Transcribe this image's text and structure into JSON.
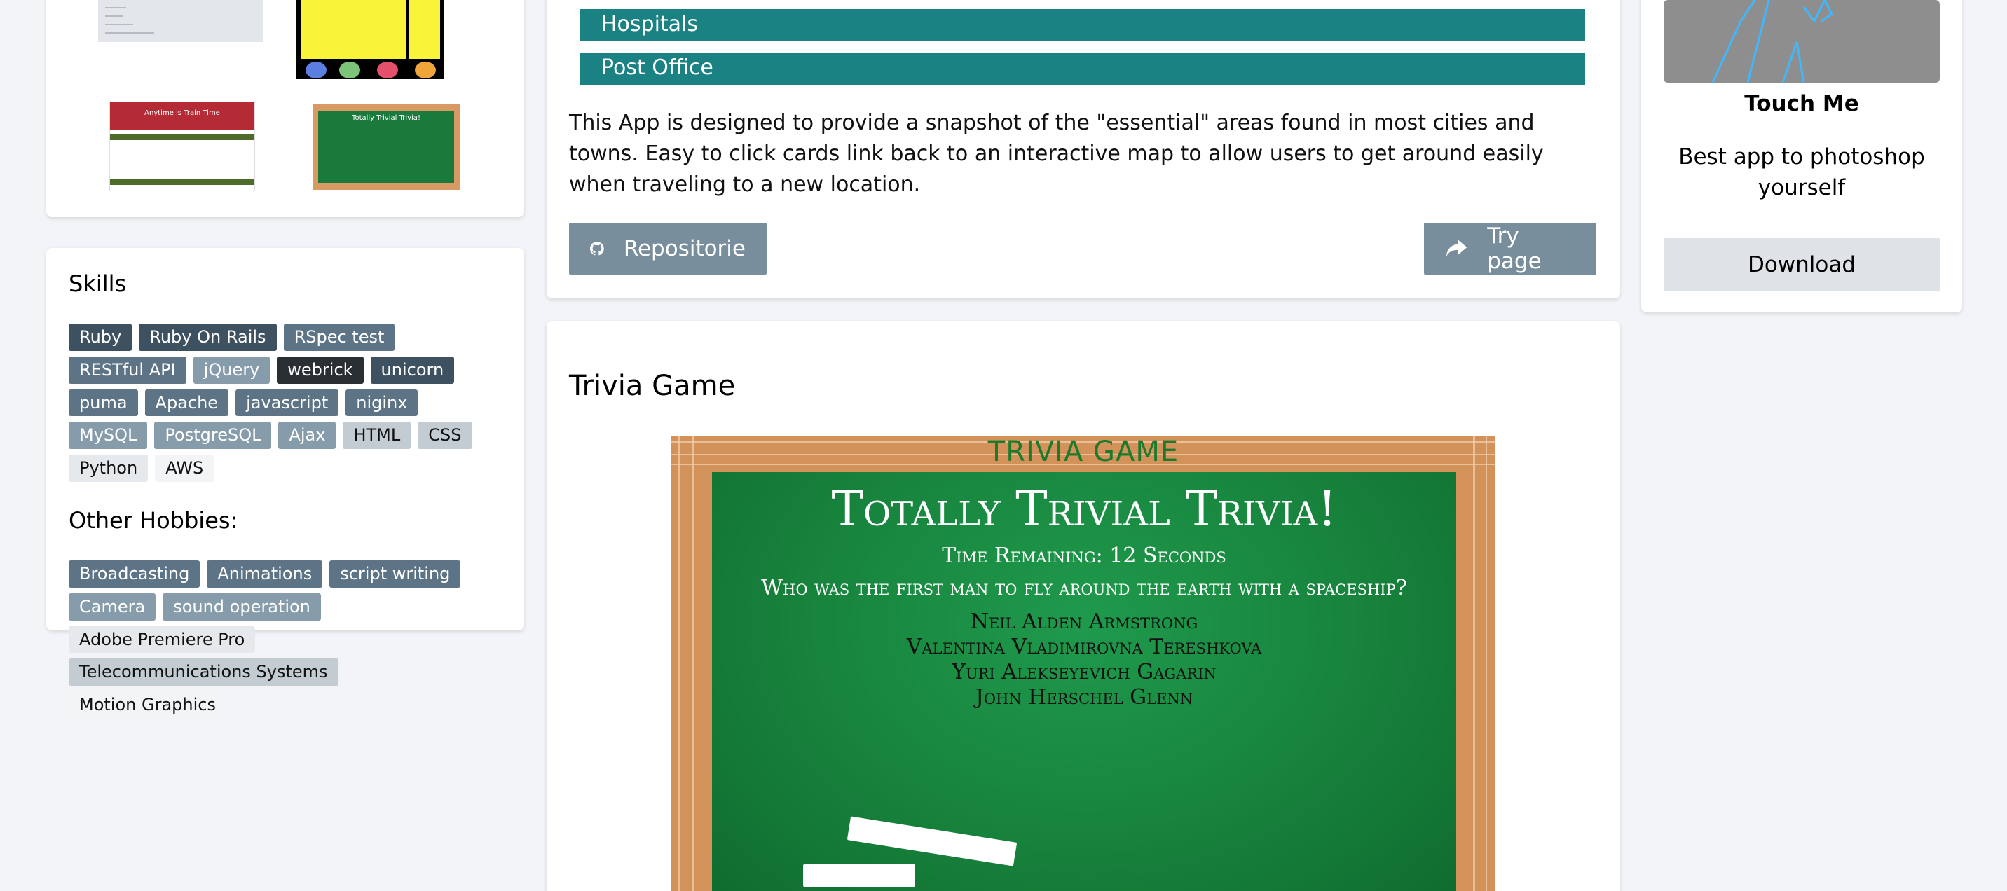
{
  "thumbnails": {
    "restaurant_banner": "Anytime is Train Time",
    "trivia_caption": "Totally Trivial Trivia!"
  },
  "skills": {
    "heading": "Skills",
    "tags": [
      "Ruby",
      "Ruby On Rails",
      "RSpec test",
      "RESTful API",
      "jQuery",
      "webrick",
      "unicorn",
      "puma",
      "Apache",
      "javascript",
      "niginx",
      "MySQL",
      "PostgreSQL",
      "Ajax",
      "HTML",
      "CSS",
      "Python",
      "AWS"
    ]
  },
  "hobbies": {
    "heading": "Other Hobbies:",
    "tags": [
      "Broadcasting",
      "Animations",
      "script writing",
      "Camera",
      "sound operation",
      "Adobe Premiere Pro",
      "Telecommunications Systems",
      "Motion Graphics"
    ]
  },
  "app_card": {
    "categories": [
      "Hospitals",
      "Post Office"
    ],
    "description": "This App is designed to provide a snapshot of the \"essential\" areas found in most cities and towns. Easy to click cards link back to an interactive map to allow users to get around easily when traveling to a new location.",
    "repo_label": "Repositorie",
    "try_label": "Try page"
  },
  "trivia": {
    "title": "Trivia Game",
    "screenshot": {
      "header": "TRIVIA GAME",
      "game_title": "Totally Trivial Trivia!",
      "timer": "Time Remaining: 12 Seconds",
      "question": "Who was the first man to fly around the earth with a spaceship?",
      "answers": [
        "Neil Alden Armstrong",
        "Valentina Vladimirovna Tereshkova",
        "Yuri Alekseyevich Gagarin",
        "John Herschel Glenn"
      ]
    }
  },
  "right_card": {
    "title": "Touch Me",
    "description": "Best app to photoshop yourself",
    "download_label": "Download"
  },
  "colors": {
    "page_bg": "#f2f4f7",
    "teal_bar": "#1b8284",
    "button_slate": "#788e9d",
    "chalkboard_green": "#17823c",
    "wood": "#d39259"
  },
  "icons": {
    "repo": "github-icon",
    "try": "share-arrow-icon"
  }
}
